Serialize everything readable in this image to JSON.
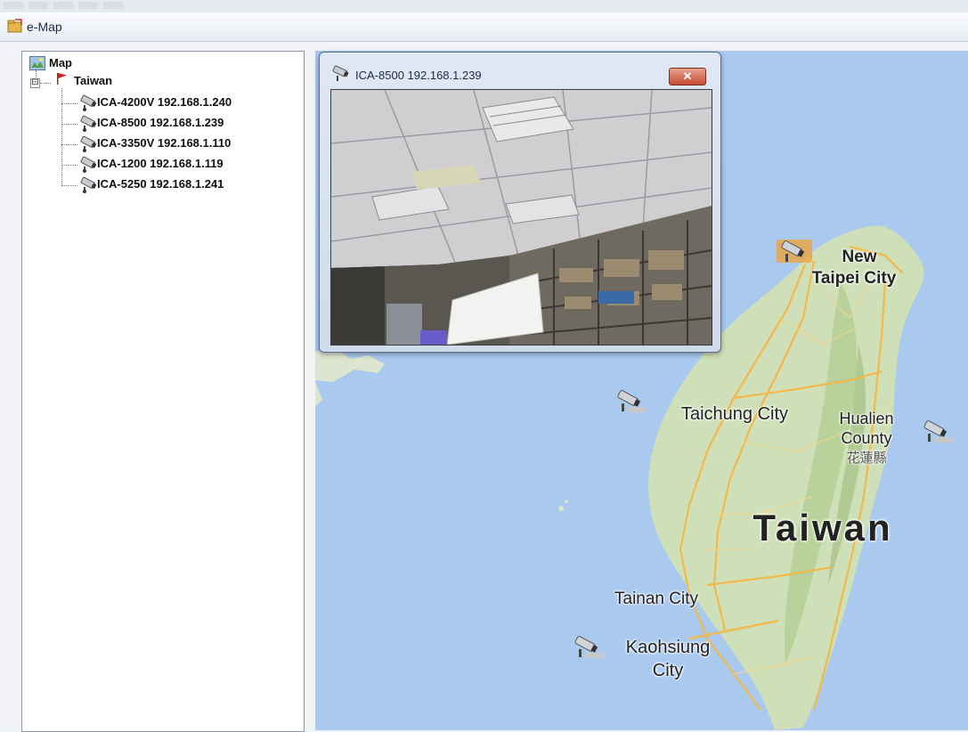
{
  "window": {
    "title": "e-Map",
    "icon": "emap-app-icon"
  },
  "tree": {
    "root": {
      "label": "Map",
      "icon": "map-icon"
    },
    "region": {
      "label": "Taiwan",
      "icon": "red-flag-icon",
      "expander": "⊟"
    },
    "cameras": [
      {
        "label": "ICA-4200V 192.168.1.240",
        "icon": "camera-icon"
      },
      {
        "label": "ICA-8500 192.168.1.239",
        "icon": "camera-icon"
      },
      {
        "label": "ICA-3350V 192.168.1.110",
        "icon": "camera-icon"
      },
      {
        "label": "ICA-1200 192.168.1.119",
        "icon": "camera-icon"
      },
      {
        "label": "ICA-5250 192.168.1.241",
        "icon": "camera-icon"
      }
    ]
  },
  "popup": {
    "title": "ICA-8500 192.168.1.239",
    "close_label": "✕",
    "icon": "camera-icon"
  },
  "map": {
    "labels": {
      "new_taipei_1": "New",
      "new_taipei_2": "Taipei City",
      "taichung": "Taichung City",
      "hualien_1": "Hualien",
      "hualien_2": "County",
      "hualien_3": "花蓮縣",
      "taiwan": "Taiwan",
      "tainan": "Tainan City",
      "kaohsiung_1": "Kaohsiung",
      "kaohsiung_2": "City"
    },
    "colors": {
      "sea": "#a9c9ee",
      "land": "#cfe0b8",
      "roads": "#f3b84a"
    }
  }
}
